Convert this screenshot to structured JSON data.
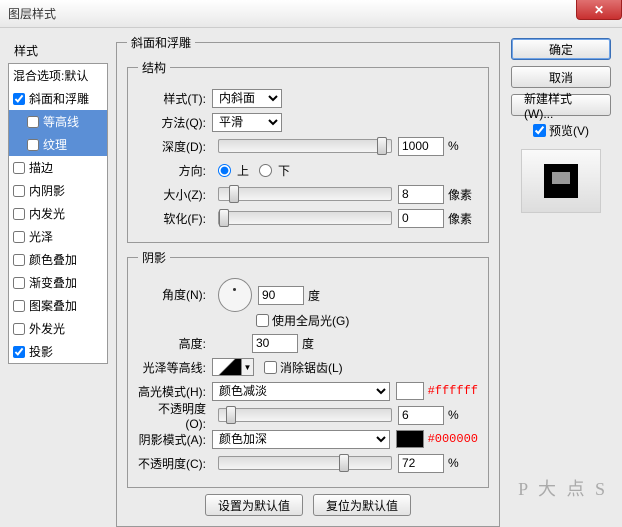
{
  "window": {
    "title": "图层样式"
  },
  "left": {
    "heading": "样式",
    "blendOptions": "混合选项:默认",
    "items": [
      {
        "label": "斜面和浮雕",
        "checked": true,
        "selected": false
      },
      {
        "label": "等高线",
        "checked": false,
        "sub": true,
        "selected": true
      },
      {
        "label": "纹理",
        "checked": false,
        "sub": true,
        "selected": true
      },
      {
        "label": "描边",
        "checked": false
      },
      {
        "label": "内阴影",
        "checked": false
      },
      {
        "label": "内发光",
        "checked": false
      },
      {
        "label": "光泽",
        "checked": false
      },
      {
        "label": "颜色叠加",
        "checked": false
      },
      {
        "label": "渐变叠加",
        "checked": false
      },
      {
        "label": "图案叠加",
        "checked": false
      },
      {
        "label": "外发光",
        "checked": false
      },
      {
        "label": "投影",
        "checked": true
      }
    ]
  },
  "bevel": {
    "groupTitle": "斜面和浮雕",
    "structTitle": "结构",
    "styleLabel": "样式(T):",
    "styleValue": "内斜面",
    "techLabel": "方法(Q):",
    "techValue": "平滑",
    "depthLabel": "深度(D):",
    "depthValue": "1000",
    "depthUnit": "%",
    "dirLabel": "方向:",
    "dirUp": "上",
    "dirDown": "下",
    "sizeLabel": "大小(Z):",
    "sizeValue": "8",
    "sizeUnit": "像素",
    "softLabel": "软化(F):",
    "softValue": "0",
    "softUnit": "像素"
  },
  "shading": {
    "title": "阴影",
    "angleLabel": "角度(N):",
    "angleValue": "90",
    "angleUnit": "度",
    "globalLabel": "使用全局光(G)",
    "altLabel": "高度:",
    "altValue": "30",
    "altUnit": "度",
    "glossLabel": "光泽等高线:",
    "antiLabel": "消除锯齿(L)",
    "hlModeLabel": "高光模式(H):",
    "hlModeValue": "颜色减淡",
    "hlColor": "#ffffff",
    "hlOpacLabel": "不透明度(O):",
    "hlOpacValue": "6",
    "pct": "%",
    "shModeLabel": "阴影模式(A):",
    "shModeValue": "颜色加深",
    "shColor": "#000000",
    "shOpacLabel": "不透明度(C):",
    "shOpacValue": "72"
  },
  "buttons": {
    "default": "设置为默认值",
    "reset": "复位为默认值"
  },
  "right": {
    "ok": "确定",
    "cancel": "取消",
    "newStyle": "新建样式(W)...",
    "previewLabel": "预览(V)"
  },
  "watermark": "P 大 点 S"
}
